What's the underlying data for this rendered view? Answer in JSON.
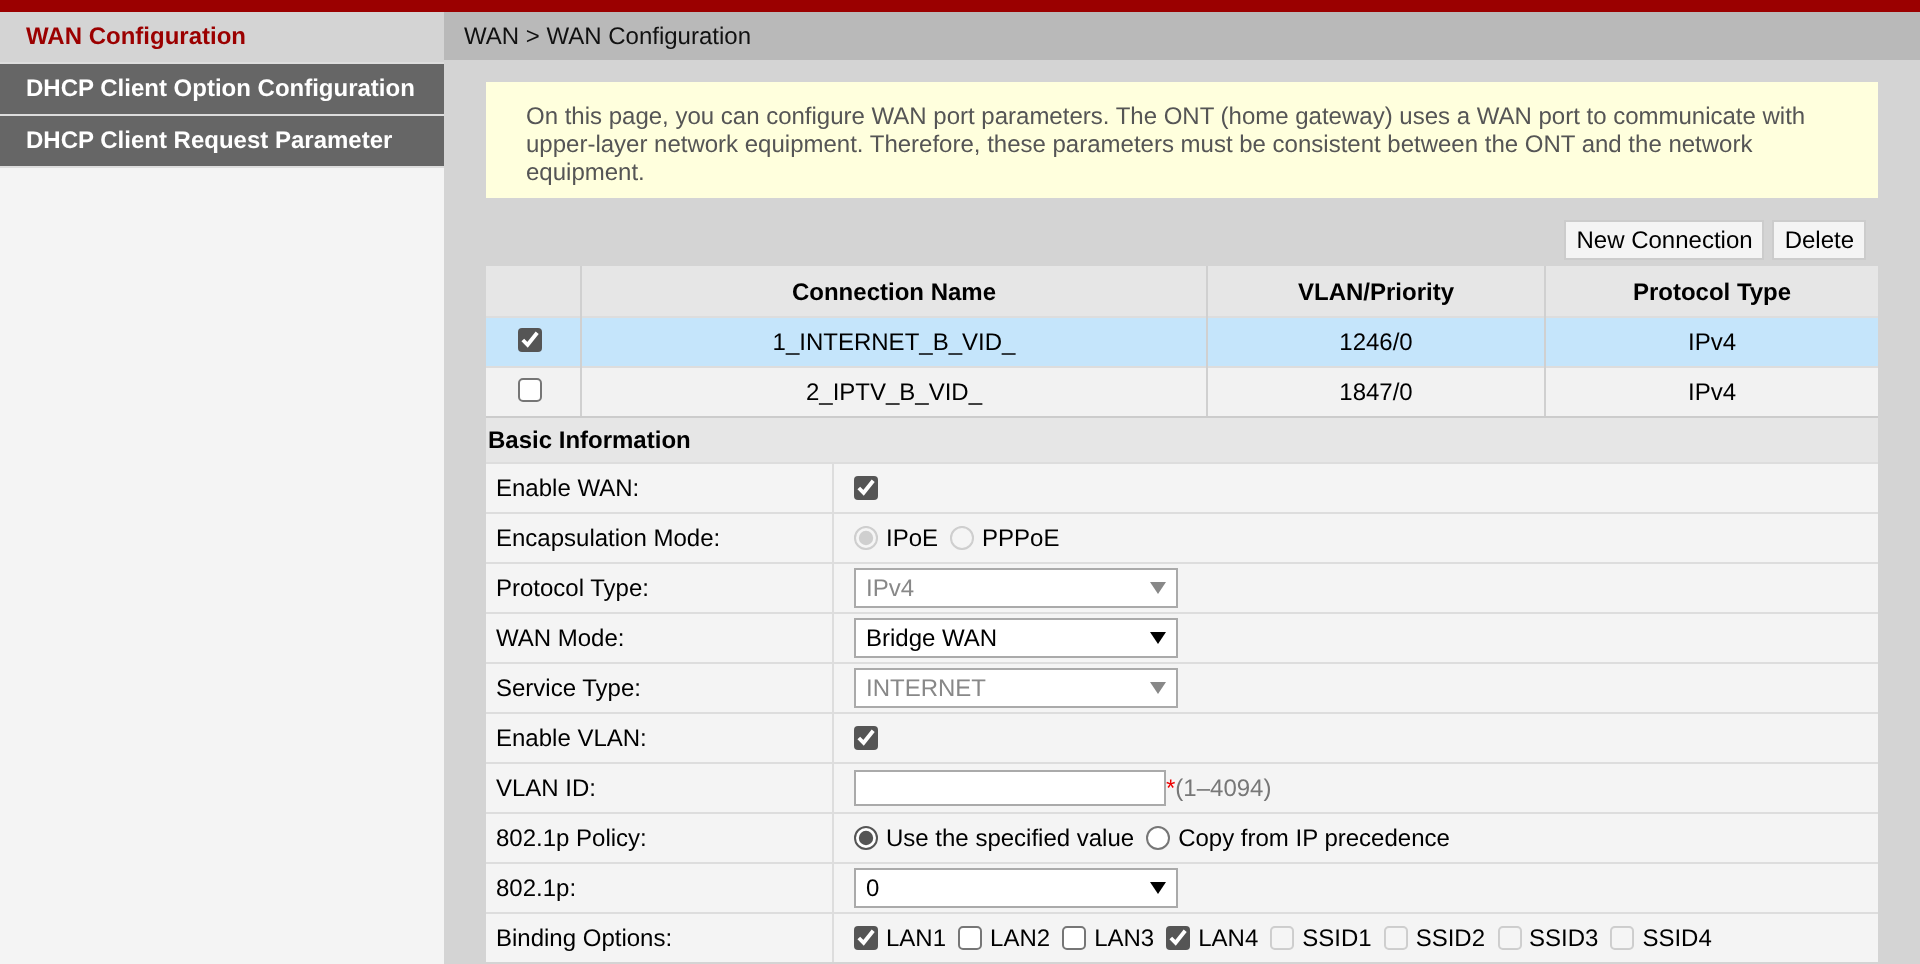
{
  "sidebar": {
    "items": [
      {
        "label": "WAN Configuration",
        "selected": true
      },
      {
        "label": "DHCP Client Option Configuration",
        "selected": false
      },
      {
        "label": "DHCP Client Request Parameter",
        "selected": false
      }
    ]
  },
  "breadcrumb": "WAN > WAN Configuration",
  "notice": "On this page, you can configure WAN port parameters. The ONT (home gateway) uses a WAN port to communicate with upper-layer network equipment. Therefore, these parameters must be consistent between the ONT and the network equipment.",
  "buttons": [
    "New Connection",
    "Delete"
  ],
  "table": {
    "columns": [
      "Connection Name",
      "VLAN/Priority",
      "Protocol Type"
    ],
    "rows": [
      {
        "checked": true,
        "selected": true,
        "cells": [
          "1_INTERNET_B_VID_",
          "1246/0",
          "IPv4"
        ]
      },
      {
        "checked": false,
        "selected": false,
        "cells": [
          "2_IPTV_B_VID_",
          "1847/0",
          "IPv4"
        ]
      }
    ]
  },
  "section_title": "Basic Information",
  "form": [
    {
      "kind": "checkbox",
      "label": "Enable WAN:",
      "checked": true
    },
    {
      "kind": "radio",
      "label": "Encapsulation Mode:",
      "options": [
        {
          "label": "IPoE",
          "selected": true,
          "disabled": true
        },
        {
          "label": "PPPoE",
          "selected": false,
          "disabled": true
        }
      ]
    },
    {
      "kind": "select",
      "label": "Protocol Type:",
      "value": "IPv4",
      "disabled": true
    },
    {
      "kind": "select",
      "label": "WAN Mode:",
      "value": "Bridge WAN",
      "disabled": false
    },
    {
      "kind": "select",
      "label": "Service Type:",
      "value": "INTERNET",
      "disabled": true
    },
    {
      "kind": "checkbox",
      "label": "Enable VLAN:",
      "checked": true
    },
    {
      "kind": "text",
      "label": "VLAN ID:",
      "required_mark": "*",
      "hint": "(1–4094)"
    },
    {
      "kind": "radio",
      "label": "802.1p Policy:",
      "options": [
        {
          "label": "Use the specified value",
          "selected": true,
          "disabled": false
        },
        {
          "label": "Copy from IP precedence",
          "selected": false,
          "disabled": false
        }
      ]
    },
    {
      "kind": "select",
      "label": "802.1p:",
      "value": "0",
      "disabled": false
    },
    {
      "kind": "checkgroup",
      "label": "Binding Options:",
      "options": [
        {
          "label": "LAN1",
          "checked": true,
          "disabled": false
        },
        {
          "label": "LAN2",
          "checked": false,
          "disabled": false
        },
        {
          "label": "LAN3",
          "checked": false,
          "disabled": false
        },
        {
          "label": "LAN4",
          "checked": true,
          "disabled": false
        },
        {
          "label": "SSID1",
          "checked": false,
          "disabled": true
        },
        {
          "label": "SSID2",
          "checked": false,
          "disabled": true
        },
        {
          "label": "SSID3",
          "checked": false,
          "disabled": true
        },
        {
          "label": "SSID4",
          "checked": false,
          "disabled": true
        }
      ]
    }
  ]
}
